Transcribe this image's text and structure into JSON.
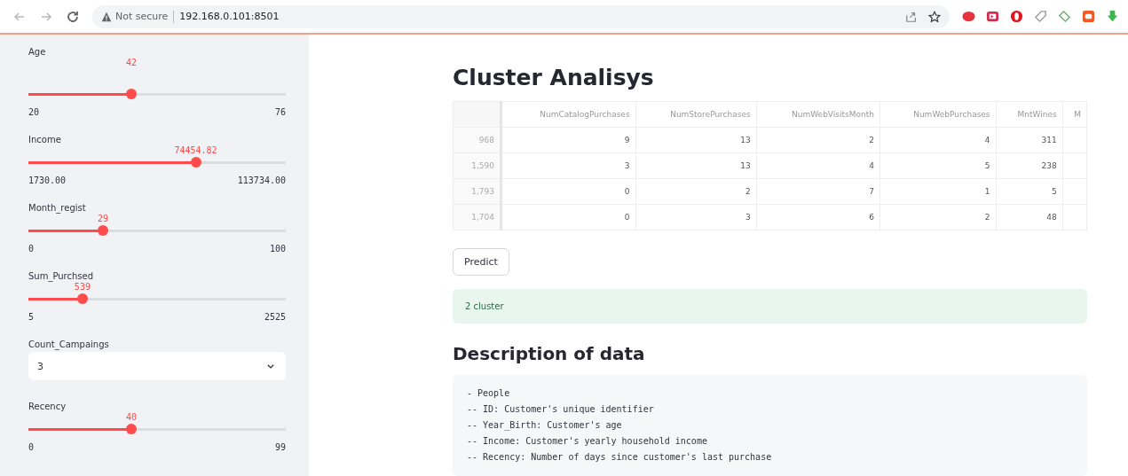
{
  "browser": {
    "security_label": "Not secure",
    "url": "192.168.0.101:8501"
  },
  "sidebar": {
    "widgets": [
      {
        "kind": "slider",
        "label": "Age",
        "value": "42",
        "min": "20",
        "max": "76",
        "level": 0.4
      },
      {
        "kind": "slider",
        "label": "Income",
        "value": "74454.82",
        "min": "1730.00",
        "max": "113734.00",
        "level": 0.65
      },
      {
        "kind": "slider",
        "label": "Month_regist",
        "value": "29",
        "min": "0",
        "max": "100",
        "level": 0.29
      },
      {
        "kind": "slider",
        "label": "Sum_Purchsed",
        "value": "539",
        "min": "5",
        "max": "2525",
        "level": 0.21
      },
      {
        "kind": "select",
        "label": "Count_Campaings",
        "value": "3"
      },
      {
        "kind": "slider",
        "label": "Recency",
        "value": "40",
        "min": "0",
        "max": "99",
        "level": 0.4
      }
    ]
  },
  "main": {
    "title": "Cluster Analisys",
    "table": {
      "columns": [
        "NumCatalogPurchases",
        "NumStorePurchases",
        "NumWebVisitsMonth",
        "NumWebPurchases",
        "MntWines",
        "M"
      ],
      "rows": [
        {
          "index": "968",
          "cells": [
            "9",
            "13",
            "2",
            "4",
            "311"
          ]
        },
        {
          "index": "1,590",
          "cells": [
            "3",
            "13",
            "4",
            "5",
            "238"
          ]
        },
        {
          "index": "1,793",
          "cells": [
            "0",
            "2",
            "7",
            "1",
            "5"
          ]
        },
        {
          "index": "1,704",
          "cells": [
            "0",
            "3",
            "6",
            "2",
            "48"
          ]
        }
      ]
    },
    "button": "Predict",
    "result": "2 cluster",
    "section_title": "Description of data",
    "code_lines": [
      "- People",
      "-- ID: Customer's unique identifier",
      "-- Year_Birth: Customer's age",
      "-- Income: Customer's yearly household income",
      "-- Recency: Number of days since customer's last purchase"
    ]
  }
}
